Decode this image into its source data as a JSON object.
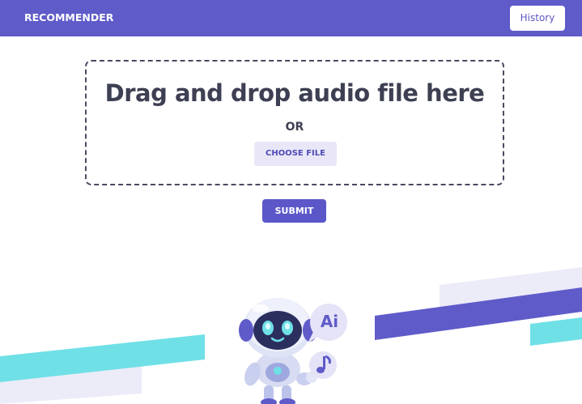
{
  "header": {
    "brand": "RECOMMENDER",
    "history_label": "History"
  },
  "upload": {
    "title": "Drag and drop audio file here",
    "or_text": "OR",
    "choose_label": "CHOOSE FILE"
  },
  "submit_label": "SUBMIT",
  "illustration": {
    "bubble_ai_text": "Ai",
    "robot_icon": "robot-mascot",
    "music_icon": "music-note-icon"
  },
  "colors": {
    "primary": "#5f5bc9",
    "accent_cyan": "#6fe0e6",
    "light_lavender": "#e9e7f7",
    "text_dark": "#3d3f52"
  }
}
